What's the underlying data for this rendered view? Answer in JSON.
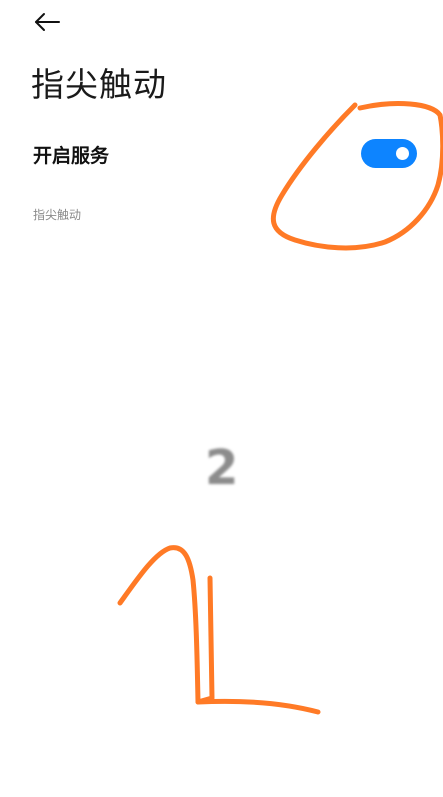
{
  "header": {
    "back_icon": "arrow-left-icon",
    "title": "指尖触动"
  },
  "settings": {
    "service_toggle": {
      "label": "开启服务",
      "state": "on"
    },
    "caption": "指尖触动"
  },
  "overlay": {
    "counter": "2"
  },
  "colors": {
    "accent": "#0d84ff",
    "annotation": "#ff7a26",
    "caption": "#8a8a8a",
    "counter": "#8c8c8c"
  }
}
